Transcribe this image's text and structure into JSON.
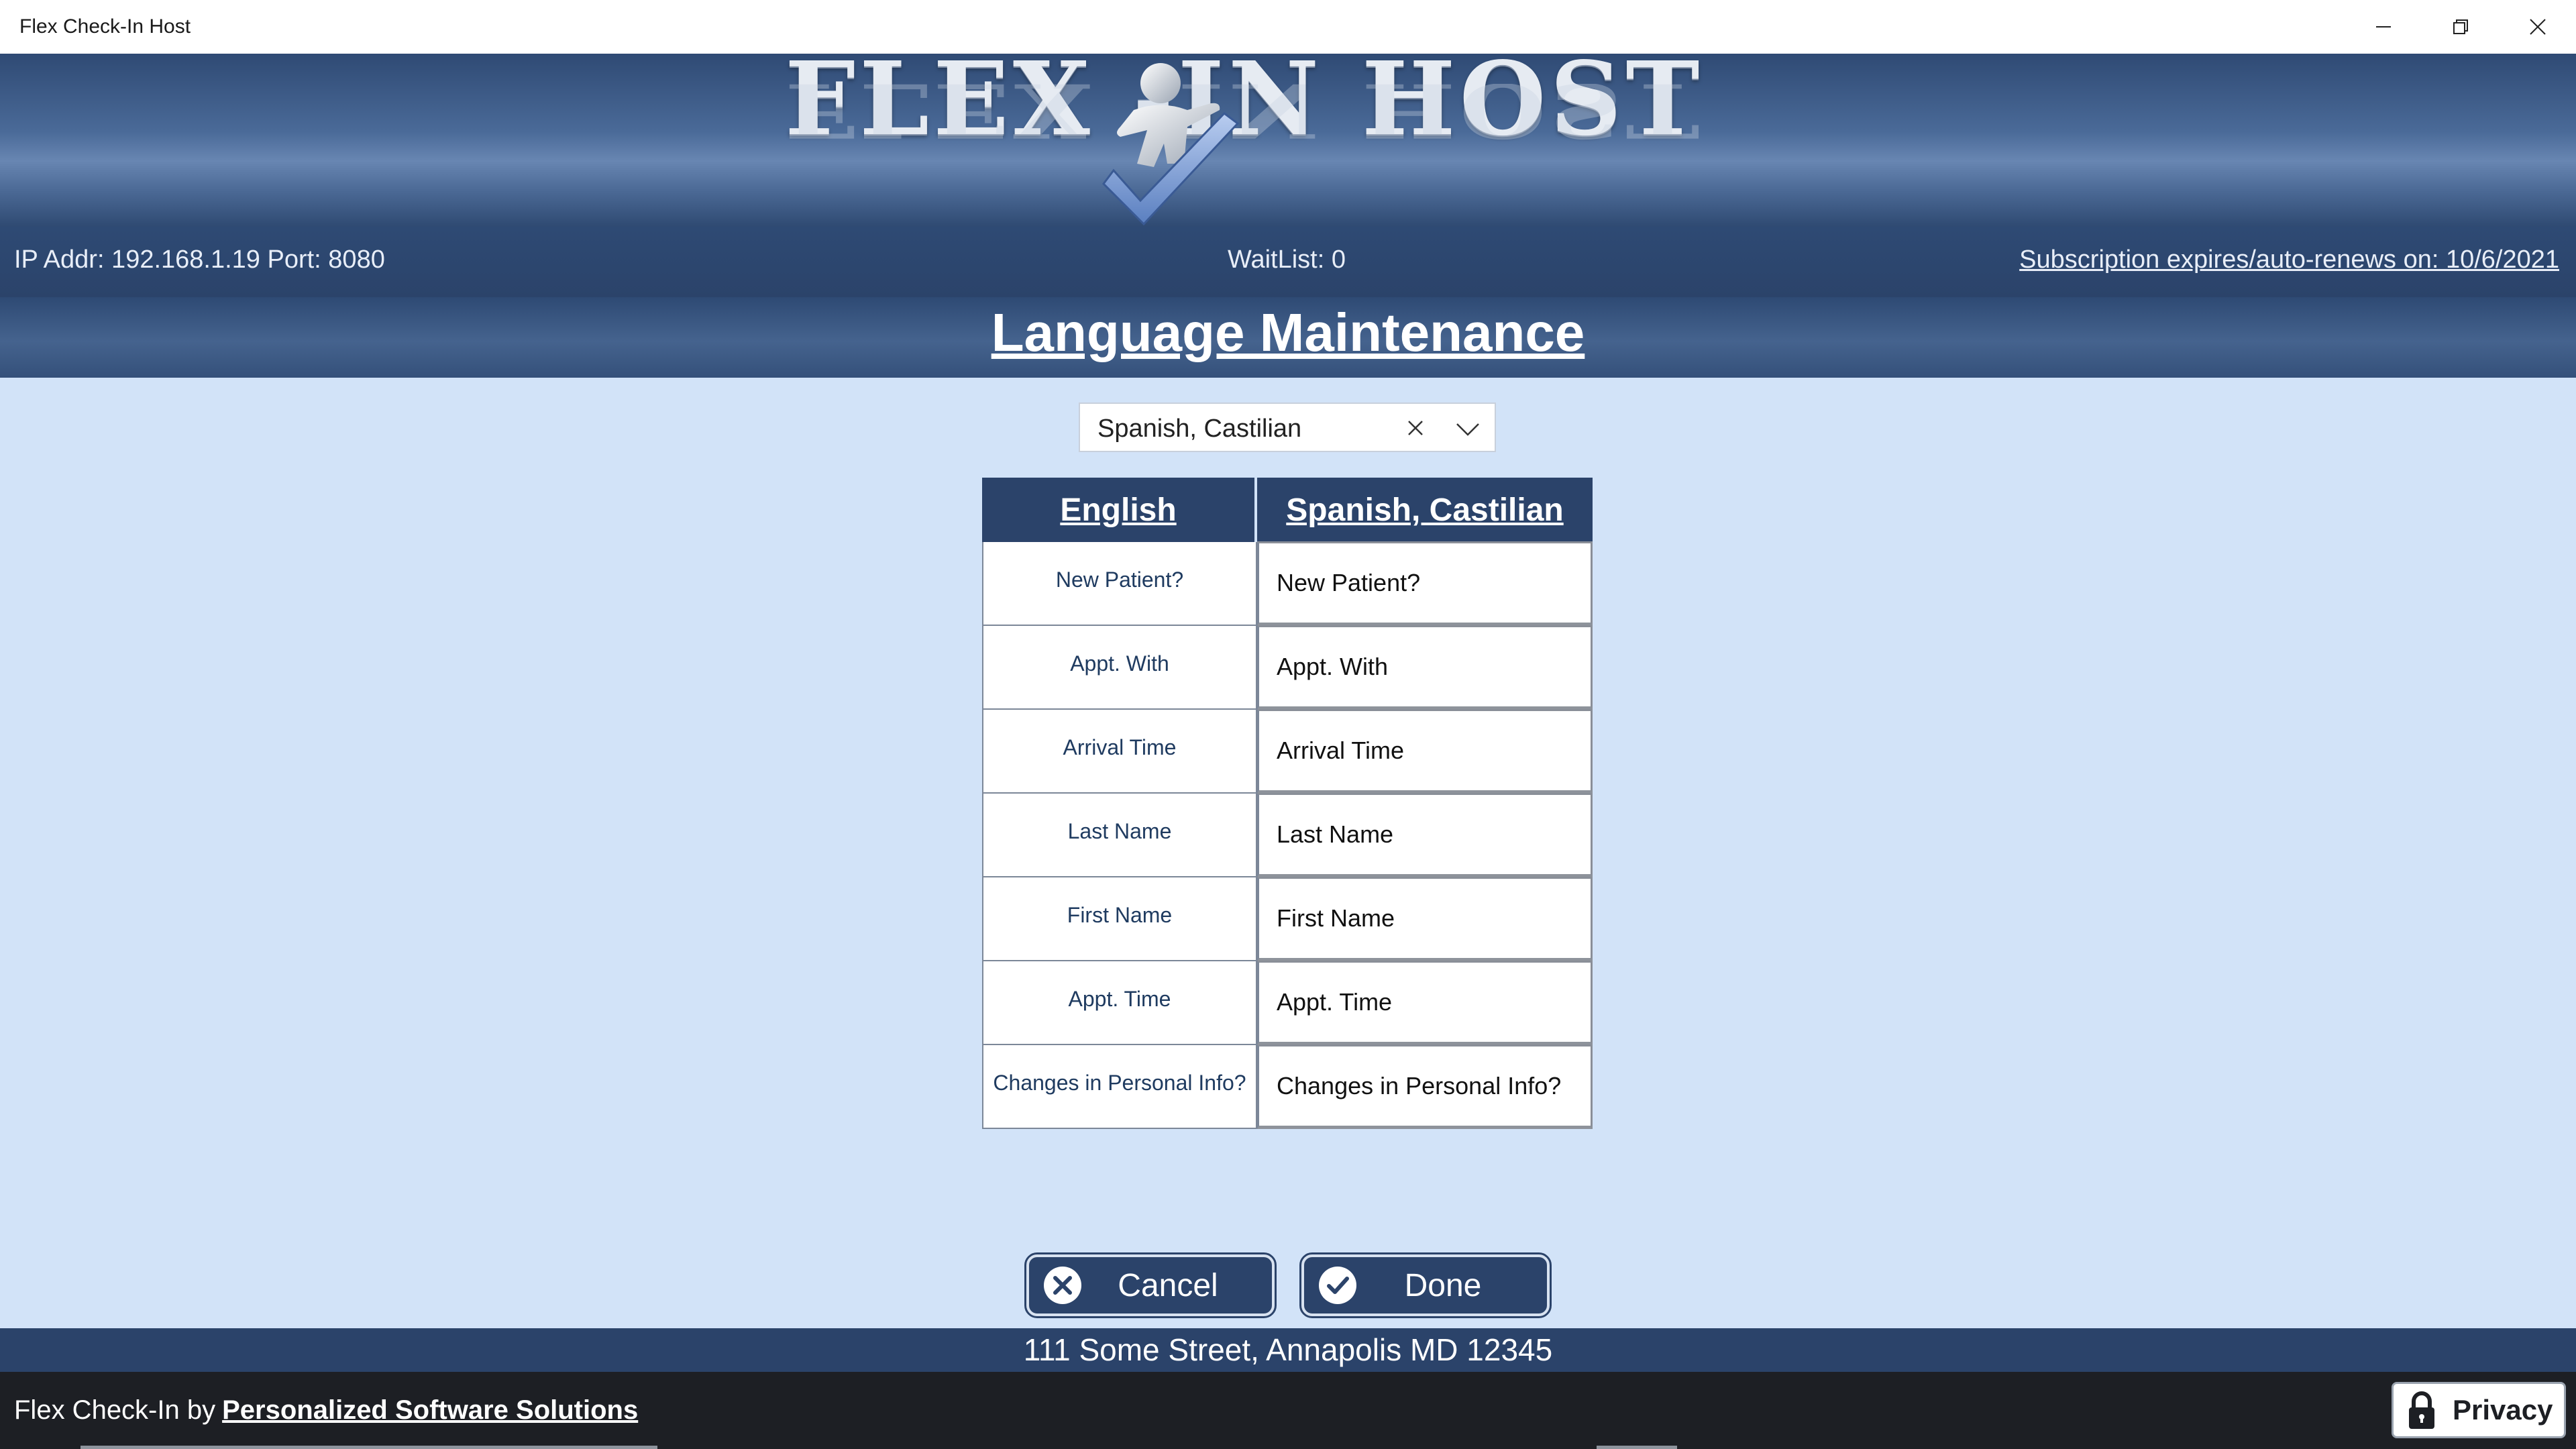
{
  "window": {
    "title": "Flex Check-In Host"
  },
  "banner": {
    "logo_text": "FLEX    -IN HOST"
  },
  "info": {
    "ip_port": "IP Addr: 192.168.1.19 Port: 8080",
    "waitlist": "WaitList: 0",
    "subscription": "Subscription expires/auto-renews on: 10/6/2021"
  },
  "page": {
    "title": "Language Maintenance"
  },
  "language_select": {
    "value": "Spanish, Castilian"
  },
  "grid": {
    "headers": {
      "english": "English",
      "translation": "Spanish, Castilian"
    },
    "rows": [
      {
        "english": "New Patient?",
        "translation": "New Patient?"
      },
      {
        "english": "Appt. With",
        "translation": "Appt. With"
      },
      {
        "english": "Arrival Time",
        "translation": "Arrival Time"
      },
      {
        "english": "Last Name",
        "translation": "Last Name"
      },
      {
        "english": "First Name",
        "translation": "First Name"
      },
      {
        "english": "Appt. Time",
        "translation": "Appt. Time"
      },
      {
        "english": "Changes in Personal Info?",
        "translation": "Changes in Personal Info?"
      }
    ]
  },
  "buttons": {
    "cancel": "Cancel",
    "done": "Done"
  },
  "address": "111 Some Street, Annapolis MD 12345",
  "footer": {
    "by_text": "Flex Check-In by",
    "company": "Personalized Software Solutions",
    "privacy": "Privacy"
  },
  "colors": {
    "background": "#d2e3f8",
    "navy": "#2b436a",
    "footer": "#1d1f24"
  }
}
